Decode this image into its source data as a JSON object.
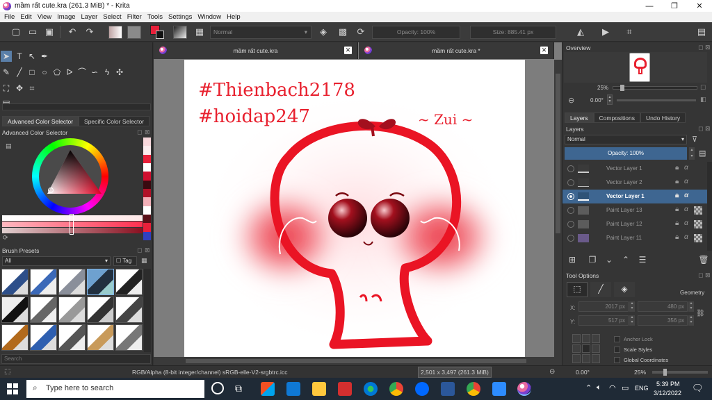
{
  "window": {
    "title": "mầm rất cute.kra (261.3 MiB)  * - Krita",
    "minimize": "—",
    "maximize": "❐",
    "close": "✕"
  },
  "menu": [
    "File",
    "Edit",
    "View",
    "Image",
    "Layer",
    "Select",
    "Filter",
    "Tools",
    "Settings",
    "Window",
    "Help"
  ],
  "toolbar": {
    "blend_mode": "Normal",
    "opacity": "Opacity: 100%",
    "size": "Size: 885.41 px"
  },
  "left_panel": {
    "color_tabs": [
      "Advanced Color Selector",
      "Specific Color Selector"
    ],
    "color_panel_title": "Advanced Color Selector",
    "brush_presets_title": "Brush Presets",
    "brush_filter": "All",
    "tag_label": "Tag",
    "search_placeholder": "Search"
  },
  "documents": [
    {
      "name": "mầm rất cute.kra"
    },
    {
      "name": "mầm rất cute.kra *"
    }
  ],
  "canvas_text": {
    "tag1": "#Thienbach2178",
    "tag2": "#hoidap247",
    "note": "~ Zui ~"
  },
  "right_panel": {
    "overview_title": "Overview",
    "zoom": "25%",
    "rotation": "0.00°",
    "tabs": [
      "Layers",
      "Compositions",
      "Undo History"
    ],
    "layers_title": "Layers",
    "blend_mode": "Normal",
    "opacity": "Opacity:  100%",
    "layers": [
      {
        "name": "Vector Layer 1",
        "active": false
      },
      {
        "name": "Vector Layer 2",
        "active": false
      },
      {
        "name": "Vector Layer 1",
        "active": true
      },
      {
        "name": "Paint Layer 13",
        "active": false
      },
      {
        "name": "Paint Layer 12",
        "active": false
      },
      {
        "name": "Paint Layer 11",
        "active": false
      }
    ],
    "tool_options_title": "Tool Options",
    "geometry_label": "Geometry",
    "x_label": "X:",
    "y_label": "Y:",
    "x_value": "2017 px",
    "y_value": "517 px",
    "w_value": "480 px",
    "h_value": "356 px",
    "anchor_lock": "Anchor Lock",
    "scale_styles": "Scale Styles",
    "global_coords": "Global Coordinates"
  },
  "statusbar": {
    "color_info": "RGB/Alpha (8-bit integer/channel)  sRGB-elle-V2-srgbtrc.icc",
    "image_size": "2,501 x 3,497 (261.3 MiB)",
    "rotation": "0.00°",
    "zoom": "25%"
  },
  "taskbar": {
    "search_placeholder": "Type here to search",
    "lang": "ENG",
    "time": "5:39 PM",
    "date": "3/12/2022"
  }
}
